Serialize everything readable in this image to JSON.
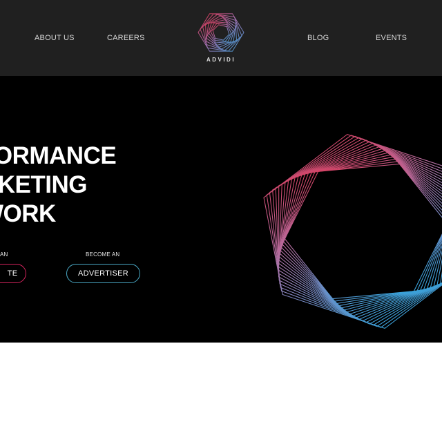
{
  "nav": {
    "about_label": "ABOUT US",
    "careers_label": "CAREERS",
    "blog_label": "BLOG",
    "events_label": "EVENTS"
  },
  "logo": {
    "text": "ADVIDI",
    "icon": "advidi-logo-icon"
  },
  "hero": {
    "headline_lines": [
      "FORMANCE",
      "RKETING",
      "WORK"
    ],
    "publisher_prefix": "AN",
    "publisher_button": "TE",
    "advertiser_prefix": "BECOME AN",
    "advertiser_button": "ADVERTISER",
    "art_icon": "abstract-line-art-icon"
  },
  "colors": {
    "header_bg": "#202020",
    "hero_bg": "#000000",
    "publisher_accent": "#d6245e",
    "advertiser_accent": "#4aa9c6",
    "art_red": "#e0304a",
    "art_blue": "#3aa0d8"
  }
}
